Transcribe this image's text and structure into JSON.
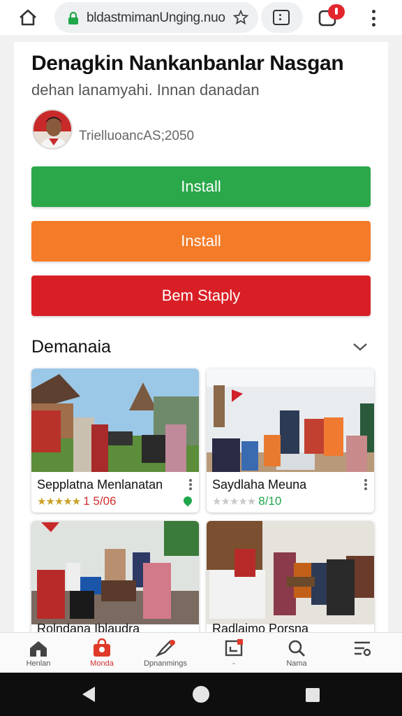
{
  "browser": {
    "url": "bldastmimanUnging.nuo",
    "home_icon": "home-outline-icon",
    "lock_icon": "lock-icon",
    "bookmark_icon": "star-outline-icon",
    "tabs_icon": "tab-switcher-icon",
    "notifications_icon": "notifications-icon",
    "menu_icon": "more-vert-icon"
  },
  "article": {
    "title": "Denagkin Nankanbanlar Nasgan",
    "subtitle": "dehan lanamyahi. Innan danadan",
    "author": "TrielluoancAS;2050"
  },
  "buttons": {
    "primary_label": "Install",
    "secondary_label": "Install",
    "tertiary_label": "Bem Staply"
  },
  "colors": {
    "green": "#2aa84a",
    "orange": "#f47b27",
    "red": "#d91f26",
    "accent": "#d12f2f"
  },
  "section": {
    "title": "Demanaia",
    "expand_icon": "chevron-down-icon"
  },
  "cards": [
    {
      "name": "Sepplatna Menlanatan",
      "stars_on": "★★★★★",
      "stars_off": "",
      "rating": "1 5/06"
    },
    {
      "name": "Saydlaha Meuna",
      "stars_on": "★",
      "stars_off": "★★★★",
      "rating": "8/10"
    },
    {
      "name": "Rolndana Iblaudra"
    },
    {
      "name": "Radlaimo Porsna"
    }
  ],
  "bottom_nav": [
    {
      "label": "Henlan",
      "icon": "home-icon"
    },
    {
      "label": "Monda",
      "icon": "shopping-bag-icon"
    },
    {
      "label": "Dpnanmings",
      "icon": "rocket-icon"
    },
    {
      "label": "-",
      "icon": "inbox-icon"
    },
    {
      "label": "Nama",
      "icon": "search-icon"
    },
    {
      "label": "",
      "icon": "settings-list-icon"
    }
  ],
  "system_nav": {
    "back_icon": "back-triangle-icon",
    "home_icon": "home-circle-icon",
    "recent_icon": "recent-square-icon"
  }
}
